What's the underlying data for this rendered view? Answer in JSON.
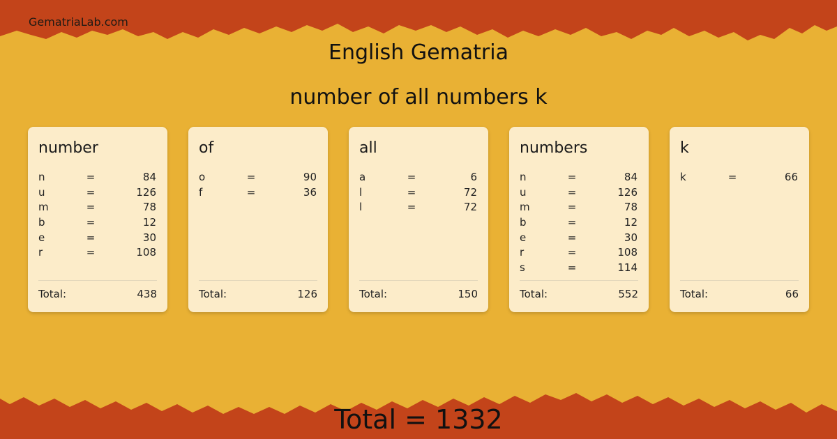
{
  "site": "GematriaLab.com",
  "title": "English Gematria",
  "phrase": "number of all numbers k",
  "total_label": "Total:",
  "grand_total": "Total = 1332",
  "colors": {
    "background": "#e9b134",
    "border": "#c3441a",
    "card": "#fdf1d6"
  },
  "words": [
    {
      "word": "number",
      "letters": [
        {
          "ch": "n",
          "val": "84"
        },
        {
          "ch": "u",
          "val": "126"
        },
        {
          "ch": "m",
          "val": "78"
        },
        {
          "ch": "b",
          "val": "12"
        },
        {
          "ch": "e",
          "val": "30"
        },
        {
          "ch": "r",
          "val": "108"
        }
      ],
      "total": "438"
    },
    {
      "word": "of",
      "letters": [
        {
          "ch": "o",
          "val": "90"
        },
        {
          "ch": "f",
          "val": "36"
        }
      ],
      "total": "126"
    },
    {
      "word": "all",
      "letters": [
        {
          "ch": "a",
          "val": "6"
        },
        {
          "ch": "l",
          "val": "72"
        },
        {
          "ch": "l",
          "val": "72"
        }
      ],
      "total": "150"
    },
    {
      "word": "numbers",
      "letters": [
        {
          "ch": "n",
          "val": "84"
        },
        {
          "ch": "u",
          "val": "126"
        },
        {
          "ch": "m",
          "val": "78"
        },
        {
          "ch": "b",
          "val": "12"
        },
        {
          "ch": "e",
          "val": "30"
        },
        {
          "ch": "r",
          "val": "108"
        },
        {
          "ch": "s",
          "val": "114"
        }
      ],
      "total": "552"
    },
    {
      "word": "k",
      "letters": [
        {
          "ch": "k",
          "val": "66"
        }
      ],
      "total": "66"
    }
  ]
}
